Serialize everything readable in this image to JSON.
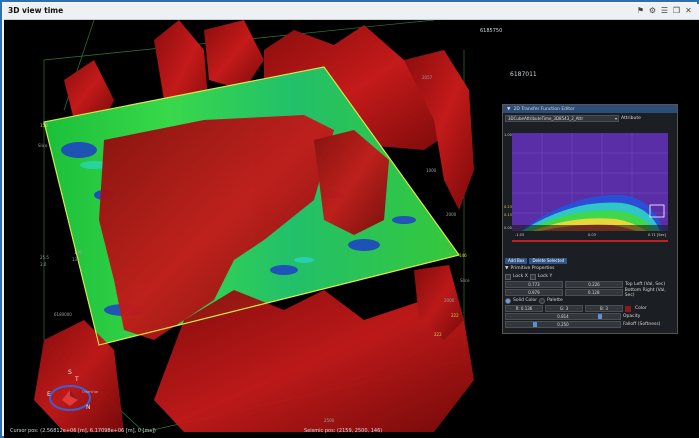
{
  "window": {
    "title": "3D view time",
    "icons": [
      "pin-icon",
      "gear-icon",
      "settings-icon",
      "restore-icon",
      "close-icon"
    ]
  },
  "viewport": {
    "header_labels": [
      "6185750",
      "6187011",
      "6187011"
    ],
    "axis_labels_left": [
      "150",
      "Slice",
      "146",
      "130",
      "25.5",
      "3.0",
      "6180000"
    ],
    "axis_labels_right": [
      "2057",
      "1000",
      "2000",
      "146",
      "Slice",
      "2000",
      "222",
      "222",
      "2500"
    ],
    "compass": {
      "north": "N",
      "south": "S",
      "east": "E",
      "top": "T",
      "label": "Orient'ae"
    }
  },
  "status_bar": {
    "cursor_pos": "Cursor pos: (2.56812e+06 [m], 6.17098e+06 [m], 0 [ms])",
    "seismic_pos": "Seismic pos: (2159, 2500, 146)"
  },
  "transfer_function_editor": {
    "title": "2D Transfer Function Editor",
    "dataset_select": "3DCubeAttributeTime_3D8543_2_Attr",
    "attribute_label": "Attribute",
    "plot": {
      "y_ticks": [
        "1.00",
        "0.23",
        "0.13",
        "0.00"
      ],
      "x_ticks": [
        "-1.03",
        "0.03",
        "0.71 [Sec]"
      ]
    },
    "add_box_button": "Add Box",
    "delete_selected_button": "Delete Selected",
    "primitive_properties_label": "Primitive Properties",
    "lock_x_label": "Lock X",
    "lock_y_label": "Lock Y",
    "top_left": {
      "x": "0.773",
      "y": "0.226",
      "label": "Top Left (Val, Sec)"
    },
    "bottom_right": {
      "x": "0.979",
      "y": "0.128",
      "label": "Bottom Right (Val, Sec)"
    },
    "solid_color_label": "Solid Color",
    "palette_label": "Palette",
    "rgb": {
      "r": "R: 0.136",
      "g": "G: 3",
      "b": "B: 3"
    },
    "color_label": "Color",
    "opacity": {
      "value": "0.814",
      "label": "Opacity",
      "fraction": 0.814
    },
    "falloff": {
      "value": "0.250",
      "label": "Falloff (Softness)",
      "fraction": 0.25
    },
    "colors": {
      "accent": "#2c4d78",
      "swatch": "#8b1a1a",
      "plot_bg": "#5a2ea6"
    }
  }
}
